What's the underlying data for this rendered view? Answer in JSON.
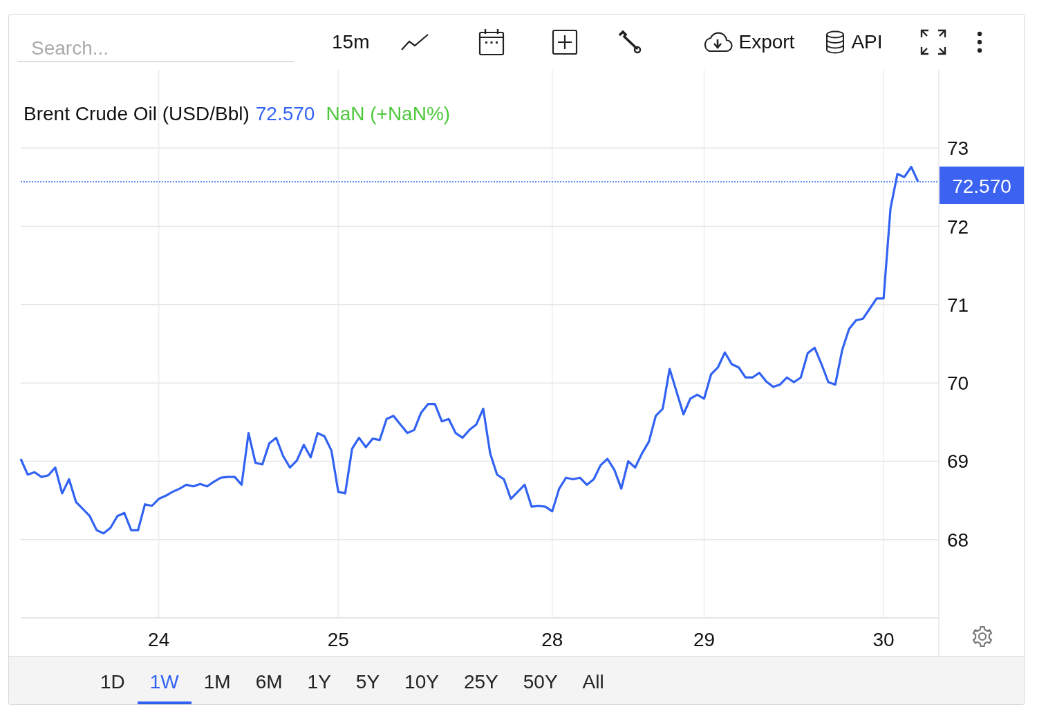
{
  "toolbar": {
    "search": {
      "placeholder": "Search..."
    },
    "interval": "15m",
    "export_label": "Export",
    "api_label": "API"
  },
  "chart": {
    "title": "Brent Crude Oil (USD/Bbl)",
    "last_price": "72.570",
    "change": "NaN (+NaN%)",
    "price_tag": "72.570",
    "chart_data": {
      "type": "line",
      "categories": [
        null,
        null,
        null,
        null,
        null,
        null,
        null,
        null,
        null,
        null,
        null,
        null,
        null,
        null,
        null,
        null,
        null,
        null,
        null,
        null,
        "24",
        null,
        null,
        null,
        null,
        null,
        null,
        null,
        null,
        null,
        null,
        null,
        null,
        null,
        null,
        null,
        null,
        null,
        null,
        null,
        null,
        null,
        null,
        null,
        null,
        null,
        "25",
        null,
        null,
        null,
        null,
        null,
        null,
        null,
        null,
        null,
        null,
        null,
        null,
        null,
        null,
        null,
        null,
        null,
        null,
        null,
        null,
        null,
        null,
        null,
        null,
        null,
        null,
        null,
        null,
        null,
        null,
        "28",
        null,
        null,
        null,
        null,
        null,
        null,
        null,
        null,
        null,
        null,
        null,
        null,
        null,
        null,
        null,
        null,
        null,
        null,
        null,
        null,
        null,
        "29",
        null,
        null,
        null,
        null,
        null,
        null,
        null,
        null,
        null,
        null,
        null,
        null,
        null,
        null,
        null,
        null,
        null,
        null,
        null,
        null,
        null,
        null,
        null,
        null,
        null,
        "30",
        null,
        null,
        null,
        null,
        null
      ],
      "series": [
        {
          "color": "#3162f2",
          "values": [
            69.03,
            68.83,
            68.86,
            68.8,
            68.82,
            68.92,
            68.59,
            68.77,
            68.48,
            68.39,
            68.3,
            68.12,
            68.08,
            68.15,
            68.3,
            68.34,
            68.12,
            68.12,
            68.45,
            68.43,
            68.52,
            68.56,
            68.61,
            68.65,
            68.7,
            68.68,
            68.71,
            68.68,
            68.74,
            68.79,
            68.8,
            68.8,
            68.7,
            69.36,
            68.98,
            68.96,
            69.23,
            69.3,
            69.07,
            68.92,
            69.01,
            69.21,
            69.05,
            69.36,
            69.32,
            69.14,
            68.61,
            68.59,
            69.16,
            69.3,
            69.18,
            69.29,
            69.27,
            69.54,
            69.58,
            69.47,
            69.36,
            69.4,
            69.62,
            69.73,
            69.73,
            69.51,
            69.54,
            69.36,
            69.3,
            69.4,
            69.47,
            69.67,
            69.1,
            68.83,
            68.77,
            68.52,
            68.61,
            68.7,
            68.42,
            68.43,
            68.42,
            68.36,
            68.65,
            68.79,
            68.77,
            68.79,
            68.7,
            68.77,
            68.95,
            69.03,
            68.89,
            68.65,
            69.0,
            68.92,
            69.1,
            69.25,
            69.58,
            69.67,
            70.18,
            69.89,
            69.6,
            69.8,
            69.85,
            69.8,
            70.11,
            70.2,
            70.39,
            70.24,
            70.2,
            70.07,
            70.07,
            70.13,
            70.02,
            69.95,
            69.98,
            70.07,
            70.01,
            70.07,
            70.38,
            70.45,
            70.24,
            70.01,
            69.98,
            70.42,
            70.69,
            70.8,
            70.82,
            70.95,
            71.08,
            71.08,
            72.23,
            72.67,
            72.63,
            72.76,
            72.57
          ]
        }
      ],
      "ylim": [
        67,
        74
      ],
      "grid": true,
      "ref_lines": [
        {
          "axis": "y",
          "value": 72.57,
          "color": "#3162f2"
        }
      ],
      "yticks": [
        68,
        69,
        70,
        71,
        72,
        73
      ]
    }
  },
  "ranges": [
    {
      "label": "1D",
      "selected": false
    },
    {
      "label": "1W",
      "selected": true
    },
    {
      "label": "1M",
      "selected": false
    },
    {
      "label": "6M",
      "selected": false
    },
    {
      "label": "1Y",
      "selected": false
    },
    {
      "label": "5Y",
      "selected": false
    },
    {
      "label": "10Y",
      "selected": false
    },
    {
      "label": "25Y",
      "selected": false
    },
    {
      "label": "50Y",
      "selected": false
    },
    {
      "label": "All",
      "selected": false
    }
  ]
}
